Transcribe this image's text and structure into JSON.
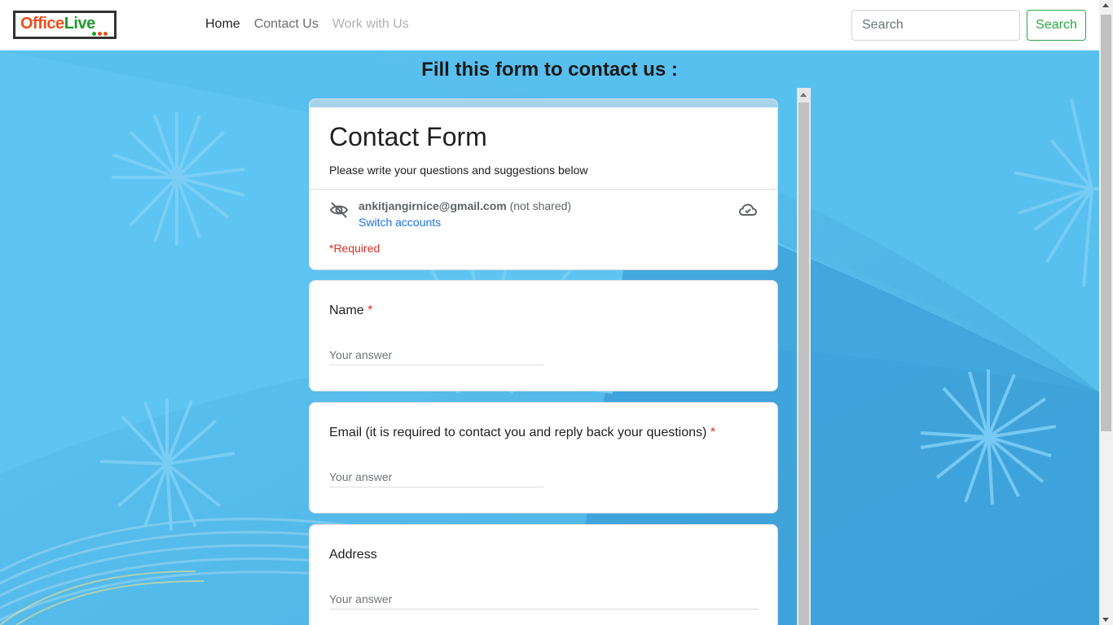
{
  "navbar": {
    "logo": "OfficeLive",
    "links": [
      "Home",
      "Contact Us",
      "Work with Us"
    ],
    "search_placeholder": "Search",
    "search_button": "Search"
  },
  "page": {
    "heading": "Fill this form to contact us :"
  },
  "form": {
    "title": "Contact Form",
    "description": "Please write your questions and suggestions below",
    "account_email": "ankitjangirnice@gmail.com",
    "not_shared": "(not shared)",
    "switch_accounts": "Switch accounts",
    "required_note": "*Required",
    "questions": [
      {
        "label": "Name",
        "required_mark": "*",
        "placeholder": "Your answer"
      },
      {
        "label": "Email (it is required to contact you and reply back your questions)",
        "required_mark": "*",
        "placeholder": "Your answer"
      },
      {
        "label": "Address",
        "required_mark": "",
        "placeholder": "Your answer"
      }
    ]
  },
  "colors": {
    "background": "#5ec5f2",
    "search_button": "#28a745",
    "link_blue": "#1a73e8",
    "required_red": "#d93025"
  },
  "icons": [
    "visibility-off-icon",
    "cloud-icon"
  ]
}
